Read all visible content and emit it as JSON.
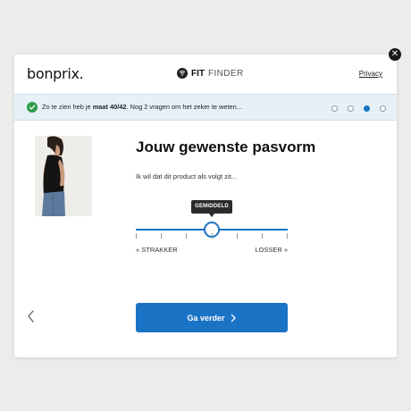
{
  "header": {
    "logo_text": "bonprix",
    "logo_dot": ".",
    "fitfinder_bold": "FIT",
    "fitfinder_light": "FINDER",
    "privacy_label": "Privacy"
  },
  "banner": {
    "text_before": "Zo te zien heb je ",
    "size_text": "maat 40/42",
    "text_after": ". Nog 2 vragen om het zeker te weten...",
    "steps_total": 4,
    "active_step": 3
  },
  "question": {
    "title": "Jouw gewenste pasvorm",
    "subtitle": "Ik wil dat dit product als volgt zit..."
  },
  "slider": {
    "tooltip": "GEMIDDELD",
    "left_label": "« STRAKKER",
    "right_label": "LOSSER »",
    "value": 0.5,
    "tick_count": 7
  },
  "footer": {
    "next_label": "Ga verder"
  },
  "colors": {
    "accent": "#1b73c6",
    "banner_bg": "#e6f0f7",
    "success": "#2e9d4b"
  },
  "icons": {
    "close": "close-icon",
    "check": "check-circle-icon",
    "fitfinder": "fit-finder-logo-icon",
    "back": "chevron-left-icon",
    "next": "chevron-right-icon"
  }
}
